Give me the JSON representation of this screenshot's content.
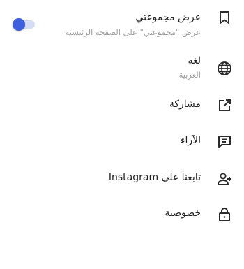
{
  "settings_menu": {
    "show_collection": {
      "title": "عرض مجموعتي",
      "subtitle": "عرض \"مجموعتي\" على الصفحة الرئيسية",
      "icon": "bookmark-icon",
      "toggle_on": true
    },
    "language": {
      "title": "لغة",
      "subtitle": "العربية",
      "icon": "globe-icon"
    },
    "share": {
      "title": "مشاركة",
      "icon": "share-icon"
    },
    "feedback": {
      "title": "الآراء",
      "icon": "feedback-icon"
    },
    "follow": {
      "title": "تابعنا على Instagram",
      "icon": "add-person-icon"
    },
    "privacy": {
      "title": "خصوصية",
      "icon": "lock-icon"
    }
  },
  "colors": {
    "accent": "#3d5fe0",
    "accent_track": "#d6dcf5",
    "text": "#212121",
    "subtext": "#9e9e9e"
  }
}
